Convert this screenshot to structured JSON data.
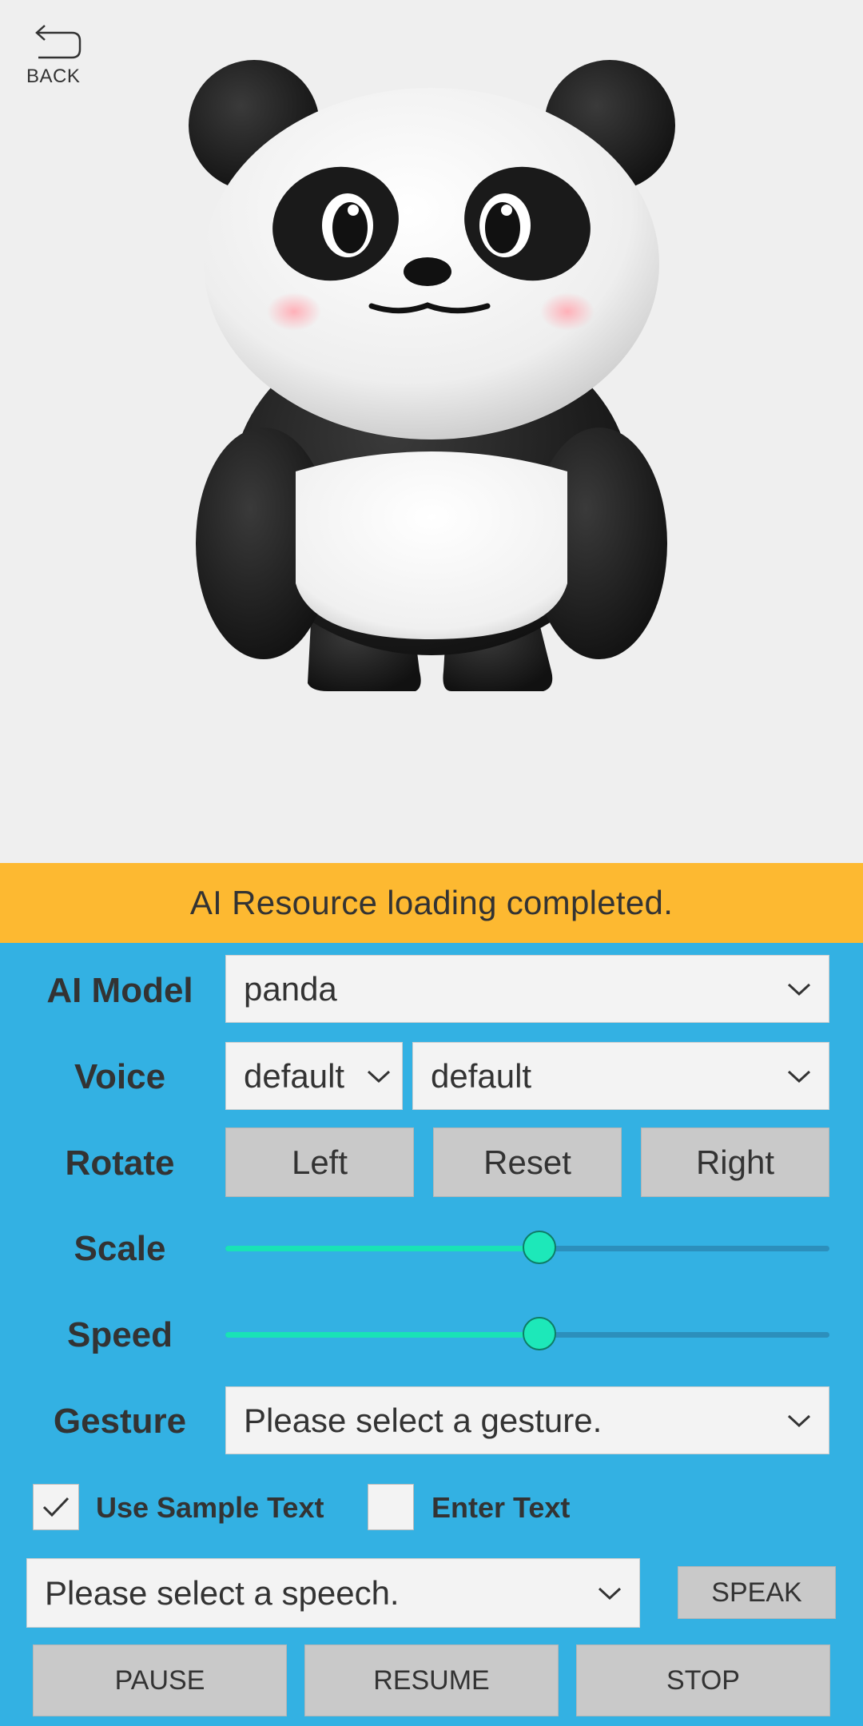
{
  "nav": {
    "back_label": "BACK"
  },
  "status": {
    "message": "AI Resource loading completed."
  },
  "controls": {
    "ai_model": {
      "label": "AI Model",
      "value": "panda"
    },
    "voice": {
      "label": "Voice",
      "value1": "default",
      "value2": "default"
    },
    "rotate": {
      "label": "Rotate",
      "left": "Left",
      "reset": "Reset",
      "right": "Right"
    },
    "scale": {
      "label": "Scale",
      "level": 0.52
    },
    "speed": {
      "label": "Speed",
      "level": 0.52
    },
    "gesture": {
      "label": "Gesture",
      "placeholder": "Please select a gesture."
    },
    "use_sample_text": {
      "label": "Use Sample Text",
      "checked": true
    },
    "enter_text": {
      "label": "Enter Text",
      "checked": false
    },
    "speech": {
      "placeholder": "Please select a speech."
    },
    "buttons": {
      "speak": "SPEAK",
      "pause": "PAUSE",
      "resume": "RESUME",
      "stop": "STOP"
    }
  },
  "colors": {
    "status_bar": "#fdb931",
    "panel": "#33b1e3",
    "slider_accent": "#1de8b9"
  },
  "icons": {
    "back": "back-arrow-icon",
    "dropdown": "chevron-down-icon",
    "checkbox": "checkmark-icon"
  }
}
